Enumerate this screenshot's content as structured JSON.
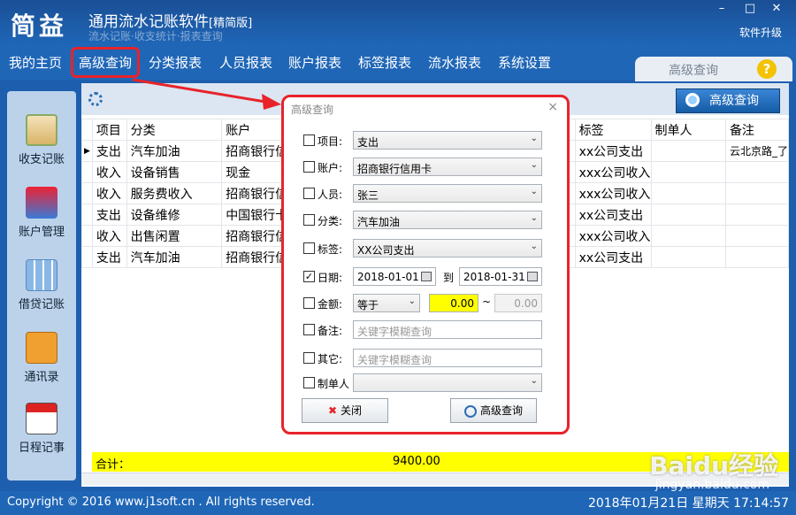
{
  "app": {
    "logo": "简益",
    "title": "通用流水记账软件",
    "edition": "[精简版]",
    "subtitle": "流水记账·收支统计·报表查询",
    "upgrade": "软件升级"
  },
  "menu": [
    "我的主页",
    "高级查询",
    "分类报表",
    "人员报表",
    "账户报表",
    "标签报表",
    "流水报表",
    "系统设置"
  ],
  "right_tab": {
    "label": "高级查询",
    "help": "?"
  },
  "sidebar": [
    "收支记账",
    "账户管理",
    "借贷记账",
    "通讯录",
    "日程记事"
  ],
  "toolbar": {
    "adv_button": "高级查询"
  },
  "table": {
    "headers": [
      "项目",
      "分类",
      "账户",
      "",
      "标签",
      "制单人",
      "备注"
    ],
    "rows": [
      [
        "支出",
        "汽车加油",
        "招商银行信",
        "",
        "xx公司支出",
        "",
        "云北京路_了"
      ],
      [
        "收入",
        "设备销售",
        "现金",
        "",
        "xxx公司收入",
        "",
        ""
      ],
      [
        "收入",
        "服务费收入",
        "招商银行信",
        "",
        "xxx公司收入",
        "",
        ""
      ],
      [
        "支出",
        "设备维修",
        "中国银行卡",
        "",
        "xx公司支出",
        "",
        ""
      ],
      [
        "收入",
        "出售闲置",
        "招商银行信",
        "",
        "xxx公司收入",
        "",
        ""
      ],
      [
        "支出",
        "汽车加油",
        "招商银行信",
        "",
        "xx公司支出",
        "",
        ""
      ]
    ],
    "total_label": "合计：",
    "total_value": "9400.00"
  },
  "dialog": {
    "title": "高级查询",
    "close": "×",
    "fields": {
      "item": {
        "label": "项目:",
        "value": "支出"
      },
      "account": {
        "label": "账户:",
        "value": "招商银行信用卡"
      },
      "person": {
        "label": "人员:",
        "value": "张三"
      },
      "category": {
        "label": "分类:",
        "value": "汽车加油"
      },
      "tag": {
        "label": "标签:",
        "value": "XX公司支出"
      },
      "date": {
        "label": "日期:",
        "from": "2018-01-01",
        "to_label": "到",
        "to": "2018-01-31",
        "checked": true
      },
      "amount": {
        "label": "金额:",
        "op": "等于",
        "min": "0.00",
        "tilde": "~",
        "max": "0.00"
      },
      "note": {
        "label": "备注:",
        "placeholder": "关键字模糊查询"
      },
      "other": {
        "label": "其它:",
        "placeholder": "关键字模糊查询"
      },
      "creator": {
        "label": "制单人",
        "value": ""
      }
    },
    "close_button": "关闭",
    "search_button": "高级查询"
  },
  "status": {
    "copyright": "Copyright © 2016 www.j1soft.cn . All rights reserved.",
    "datetime": "2018年01月21日  星期天  17:14:57"
  },
  "watermark": {
    "brand": "Baidu经验",
    "site": "jingyan.baidu.com"
  },
  "colors": {
    "highlight": "#e8232a",
    "total_bg": "#ffff00",
    "primary": "#1f66b7"
  }
}
